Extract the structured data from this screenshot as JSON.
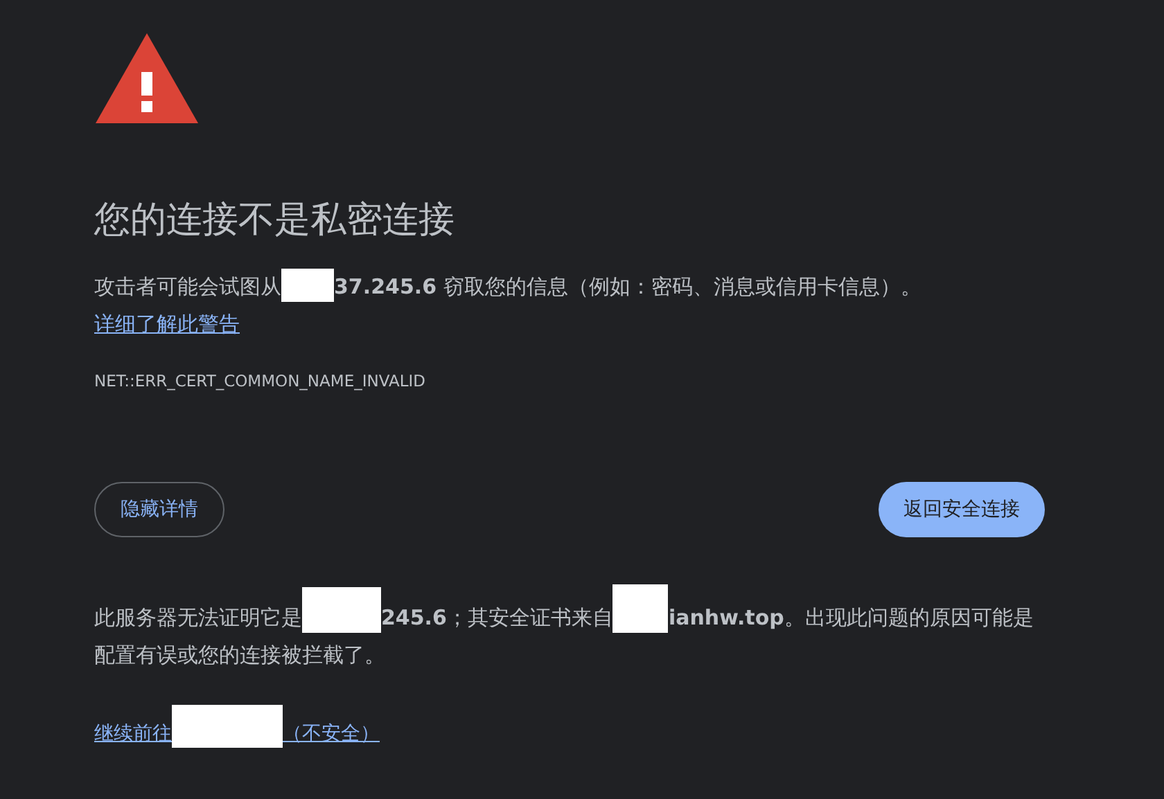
{
  "title": "您的连接不是私密连接",
  "summary": [
    {
      "kind": "text",
      "text": "攻击者可能会试图从"
    },
    {
      "kind": "redaction"
    },
    {
      "kind": "text",
      "text": "**37.245.6** 窃取您的信息（例如：密码、消息或信用卡信息）。"
    },
    {
      "kind": "link",
      "text": "详细了解此警告"
    }
  ],
  "error_code": "NET::ERR_CERT_COMMON_NAME_INVALID",
  "buttons": [
    {
      "kind": "outline",
      "label": "隐藏详情"
    },
    {
      "kind": "primary",
      "label": "返回安全连接"
    }
  ],
  "details": [
    {
      "kind": "text",
      "text": "此服务器无法证明它是"
    },
    {
      "kind": "redaction"
    },
    {
      "kind": "text",
      "text": "**245.6**；其安全证书来自"
    },
    {
      "kind": "redaction"
    },
    {
      "kind": "text",
      "text": "**ianhw.top**。出现此问题的原因可能是配置有误或您的连接被拦截了。"
    }
  ],
  "proceed": [
    {
      "kind": "link",
      "text": "继续前往"
    },
    {
      "kind": "redaction"
    },
    {
      "kind": "link",
      "text": "（不安全）"
    }
  ]
}
